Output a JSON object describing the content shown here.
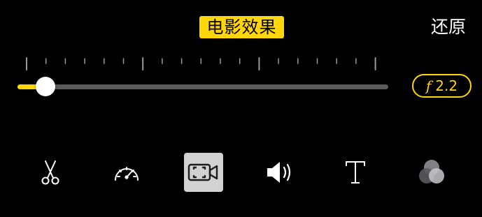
{
  "header": {
    "mode_label": "电影效果",
    "reset_label": "还原"
  },
  "aperture": {
    "symbol": "f",
    "value": "2.2"
  },
  "slider": {
    "value_fraction": 0.075
  },
  "toolbar": {
    "tools": [
      {
        "icon": "scissors-icon",
        "selected": false
      },
      {
        "icon": "speedometer-icon",
        "selected": false
      },
      {
        "icon": "cinematic-video-icon",
        "selected": true
      },
      {
        "icon": "speaker-icon",
        "selected": false
      },
      {
        "icon": "text-icon",
        "selected": false
      },
      {
        "icon": "filters-icon",
        "selected": false
      }
    ]
  },
  "colors": {
    "accent": "#ffd60a",
    "background": "#000000",
    "track": "#5b5b5b",
    "selected_tool_bg": "#d2d2d2"
  }
}
